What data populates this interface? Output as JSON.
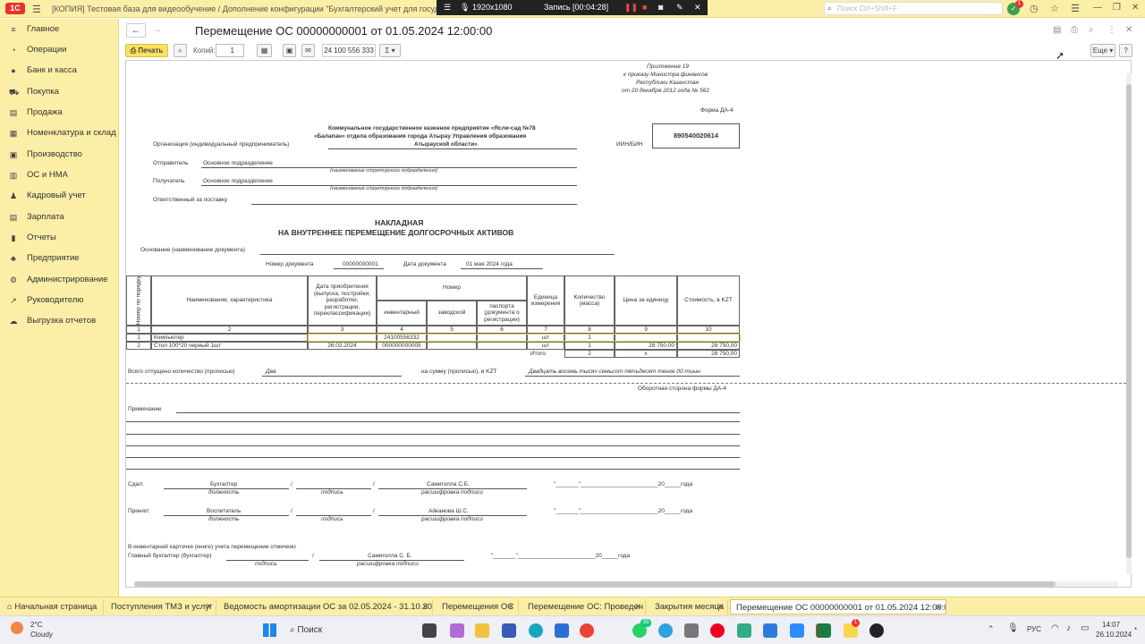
{
  "titlebar": {
    "logo": "1С",
    "title": "[КОПИЯ] Тестовая база для видеообучение / Дополнение конфигурации \"Бухгалтерский учет для государственных предпр...",
    "search_placeholder": "Поиск Ctrl+Shift+F",
    "notif_count": "1"
  },
  "recorder": {
    "resolution": "1920x1080",
    "status": "Запись [00:04:28]"
  },
  "sidebar": {
    "items": [
      {
        "label": "Главное",
        "icon": "≡"
      },
      {
        "label": "Операции",
        "icon": "◔"
      },
      {
        "label": "Банк и касса",
        "icon": "●"
      },
      {
        "label": "Покупка",
        "icon": "⛟"
      },
      {
        "label": "Продажа",
        "icon": "▤"
      },
      {
        "label": "Номенклатура и склад",
        "icon": "▦"
      },
      {
        "label": "Производство",
        "icon": "▣"
      },
      {
        "label": "ОС и НМА",
        "icon": "▥"
      },
      {
        "label": "Кадровый учет",
        "icon": "♟"
      },
      {
        "label": "Зарплата",
        "icon": "▤"
      },
      {
        "label": "Отчеты",
        "icon": "▮"
      },
      {
        "label": "Предприятие",
        "icon": "♣"
      },
      {
        "label": "Администрирование",
        "icon": "⚙"
      },
      {
        "label": "Руководителю",
        "icon": "↗"
      },
      {
        "label": "Выгрузка отчетов",
        "icon": "☁"
      }
    ]
  },
  "document": {
    "title": "Перемещение ОС 00000000001 от 01.05.2024 12:00:00"
  },
  "toolbar": {
    "print": "Печать",
    "copies_label": "Копий:",
    "copies_value": "1",
    "sum_value": "24 100 556 333",
    "sigma": "Σ",
    "more": "Еще",
    "help": "?"
  },
  "form": {
    "appendix": [
      "Приложение 19",
      "к приказу Министра финансов",
      "Республики Казахстан",
      "от 20 декабря 2012 года № 562"
    ],
    "form_name": "Форма ДА-4",
    "org_label": "Организация (индивидуальный предприниматель)",
    "org_name": [
      "Коммунальное государственное казенное предприятие «Ясли-сад №78",
      "«Балапан» отдела образования города Атырау Управления образования",
      "Атырауской области»"
    ],
    "iin_label": "ИИН/БИН",
    "iin": "890540020614",
    "sender_label": "Отправитель",
    "sender": "Основное подразделение",
    "sender_hint": "(наименование структурного подразделения)",
    "receiver_label": "Получатель",
    "receiver": "Основное подразделение",
    "receiver_hint": "(наименование структурного подразделения)",
    "responsible_label": "Ответственный за поставку",
    "heading1": "НАКЛАДНАЯ",
    "heading2": "НА ВНУТРЕННЕЕ ПЕРЕМЕЩЕНИЕ ДОЛГОСРОЧНЫХ АКТИВОВ",
    "basis_label": "Основание (наименование документа)",
    "docnum_label": "Номер документа",
    "docnum": "00000000001",
    "docdate_label": "Дата документа",
    "docdate": "01 мая 2024 года",
    "cols": {
      "num": "Номер по порядку",
      "name": "Наименование, характеристика",
      "date": "Дата приобретения (выпуска, постройки, разработки, регистрации, переклассификации)",
      "number": "Номер",
      "inv": "инвентарный",
      "factory": "заводской",
      "passport": "паспорта (документа о регистрации)",
      "unit": "Единица измерения",
      "qty": "Количество (масса)",
      "price": "Цена за единицу",
      "cost": "Стоимость, в KZT"
    },
    "col_numbers": [
      "1",
      "2",
      "3",
      "4",
      "5",
      "6",
      "7",
      "8",
      "9",
      "10"
    ],
    "rows": [
      {
        "n": "1",
        "name": "Компьютер",
        "date": "",
        "inv": "24100556332",
        "factory": "",
        "passport": "",
        "unit": "шт",
        "qty": "1",
        "price": "",
        "cost": ""
      },
      {
        "n": "2",
        "name": "Стол 100*20 черный 1шт",
        "date": "26.02.2024",
        "inv": "000000000005",
        "factory": "",
        "passport": "",
        "unit": "шт",
        "qty": "1",
        "price": "28 750,00",
        "cost": "28 750,00"
      }
    ],
    "total_label": "Итого",
    "total_qty": "2",
    "total_x": "х",
    "total_cost": "28 750,00",
    "released_label": "Всего отпущено количество (прописью)",
    "released": "Два",
    "sum_label": "на сумму (прописью), в KZT",
    "sum_words": "Двадцать восемь тысяч семьсот пятьдесят тенге 00 тиын",
    "back_side": "Оборотная сторона формы ДА-4",
    "note_label": "Примечание",
    "gave_label": "Сдал:",
    "gave_pos": "Бухгалтер",
    "gave_name": "Самиголла С.Б.",
    "took_label": "Принял:",
    "took_pos": "Воспитатель",
    "took_name": "Айканова Ш.С.",
    "pos_hint": "должность",
    "sign_hint": "подпись",
    "decode_hint": "расшифровка подписи",
    "date_tpl1": "\"_______\"________________________20_____года",
    "date_tpl2": "\"_______\"________________________20_____года",
    "date_tpl3": "\"_______\"________________________20_____года",
    "card_note": "В инвентарной карточке (книге) учета перемещение отмечено",
    "chief_label": "Главный бухгалтер (бухгалтер)",
    "chief_name": "Самиголла С. Б.",
    "slash": "/"
  },
  "tabs": [
    {
      "label": "Начальная страница"
    },
    {
      "label": "Поступления ТМЗ и услуг"
    },
    {
      "label": "Ведомость амортизации ОС  за 02.05.2024 - 31.10.2024"
    },
    {
      "label": "Перемещения ОС"
    },
    {
      "label": "Перемещение ОС: Проведен"
    },
    {
      "label": "Закрытия месяца"
    },
    {
      "label": "Перемещение ОС 00000000001 от 01.05.2024 12:00:00"
    }
  ],
  "taskbar": {
    "weather_temp": "2°C",
    "weather_desc": "Cloudy",
    "search": "Поиск",
    "lang": "РУС",
    "time": "14:07",
    "date": "26.10.2024",
    "badge1": "35",
    "badge2": "1"
  }
}
